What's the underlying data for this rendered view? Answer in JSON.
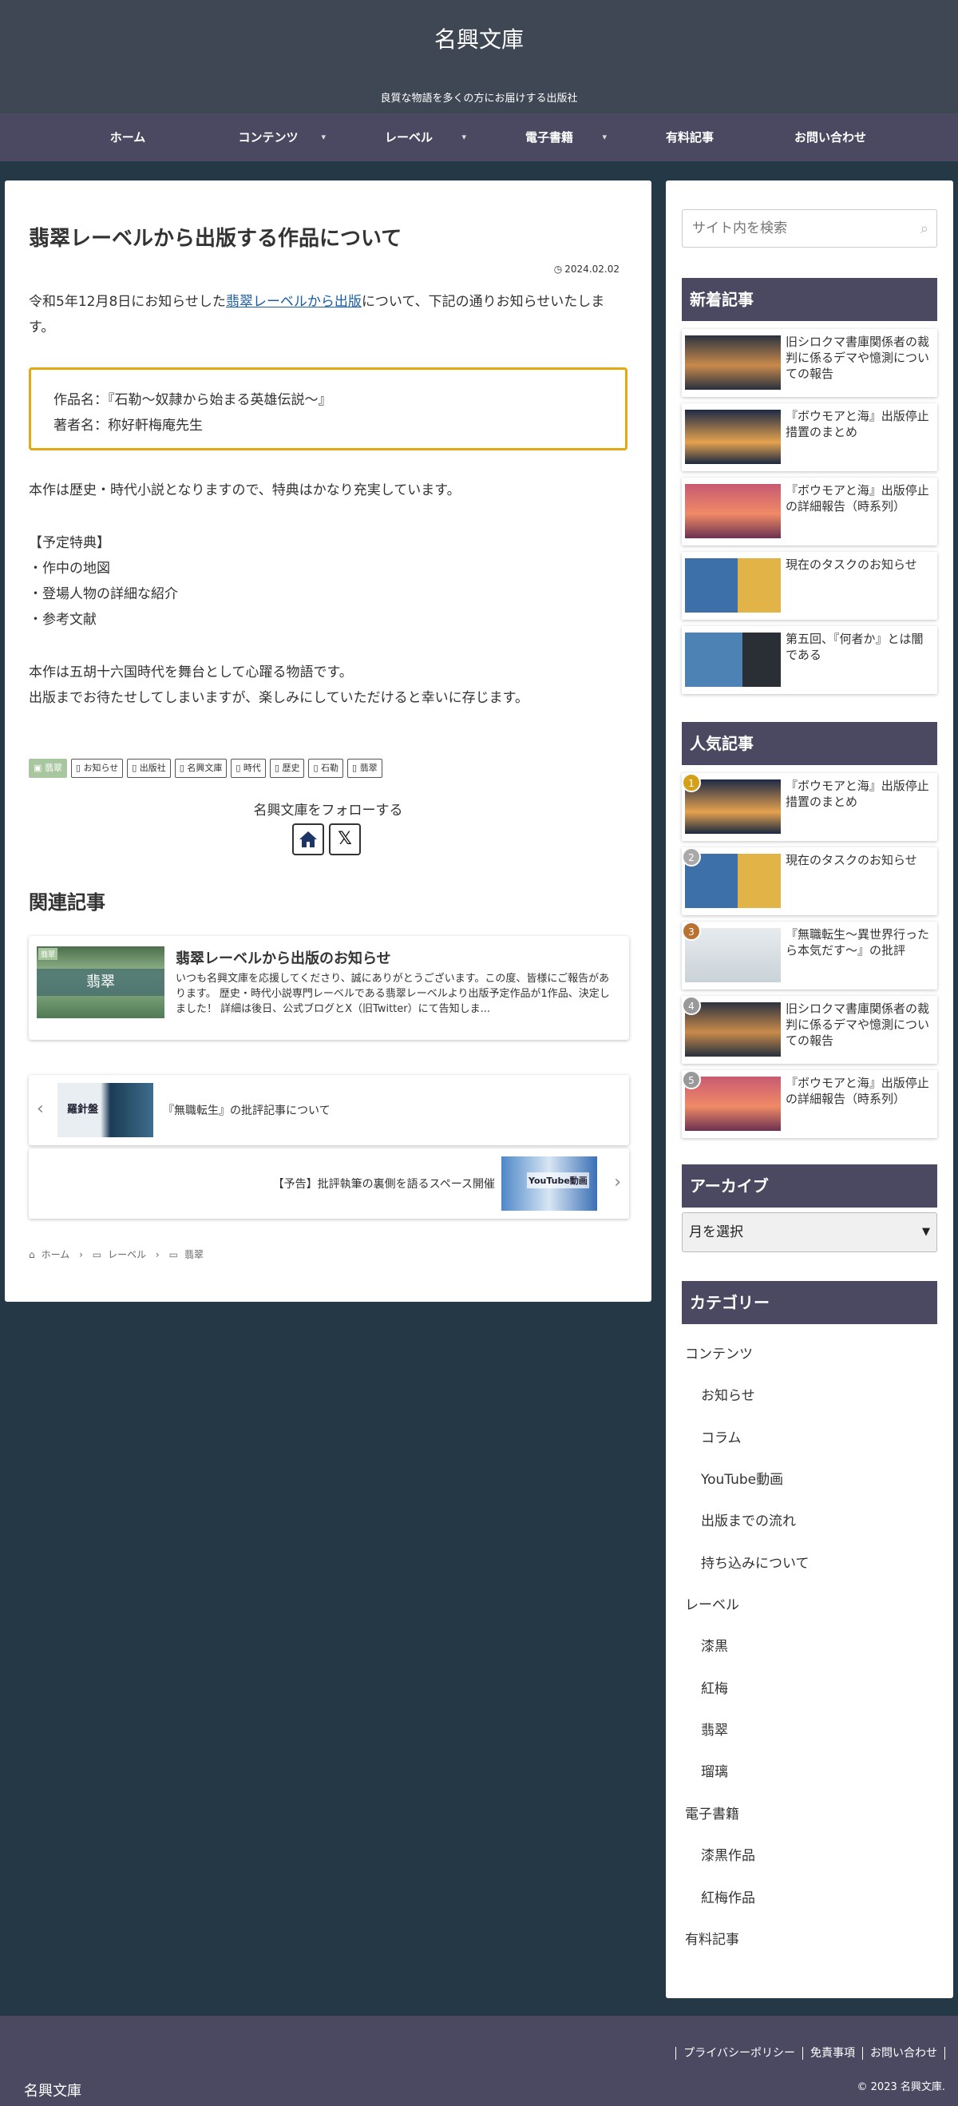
{
  "header": {
    "title": "名興文庫",
    "tagline": "良質な物語を多くの方にお届けする出版社"
  },
  "nav": {
    "items": [
      {
        "label": "ホーム"
      },
      {
        "label": "コンテンツ"
      },
      {
        "label": "レーベル"
      },
      {
        "label": "電子書籍"
      },
      {
        "label": "有料記事"
      },
      {
        "label": "お問い合わせ"
      }
    ]
  },
  "article": {
    "title": "翡翠レーベルから出版する作品について",
    "date": "2024.02.02",
    "intro_prefix": "令和5年12月8日にお知らせした",
    "intro_link": "翡翠レーベルから出版",
    "intro_suffix": "について、下記の通りお知らせいたします。",
    "box_line1": "作品名：『石勒〜奴隷から始まる英雄伝説〜』",
    "box_line2": "著者名：称好軒梅庵先生",
    "para2": "本作は歴史・時代小説となりますので、特典はかなり充実しています。",
    "bonus_head": "【予定特典】",
    "bonus_1": "・作中の地図",
    "bonus_2": "・登場人物の詳細な紹介",
    "bonus_3": "・参考文献",
    "para3a": "本作は五胡十六国時代を舞台として心躍る物語です。",
    "para3b": "出版までお待たせしてしまいますが、楽しみにしていただけると幸いに存じます。"
  },
  "tags": {
    "category": "翡翠",
    "items": [
      "お知らせ",
      "出版社",
      "名興文庫",
      "時代",
      "歴史",
      "石勒",
      "翡翠"
    ]
  },
  "follow": {
    "label": "名興文庫をフォローする"
  },
  "related": {
    "heading": "関連記事",
    "card": {
      "thumb_label": "翡翠",
      "thumb_text": "翡翠",
      "title": "翡翠レーベルから出版のお知らせ",
      "excerpt": "いつも名興文庫を応援してくださり、誠にありがとうございます。この度、皆様にご報告があります。 歴史・時代小説専門レーベルである翡翠レーベルより出版予定作品が1作品、決定しました！ 詳細は後日、公式ブログとX（旧Twitter）にて告知しま..."
    }
  },
  "prev_next": {
    "prev_text": "『無職転生』の批評記事について",
    "prev_thumb": "羅針盤",
    "next_text": "【予告】批評執筆の裏側を語るスペース開催",
    "next_thumb": "YouTube動画"
  },
  "breadcrumb": [
    "ホーム",
    "レーベル",
    "翡翠"
  ],
  "sidebar": {
    "search_placeholder": "サイト内を検索",
    "new_heading": "新着記事",
    "new_posts": [
      "旧シロクマ書庫関係者の裁判に係るデマや憶測についての報告",
      "『ボウモアと海』出版停止措置のまとめ",
      "『ボウモアと海』出版停止の詳細報告（時系列）",
      "現在のタスクのお知らせ",
      "第五回、『何者か』とは闇である"
    ],
    "popular_heading": "人気記事",
    "popular_posts": [
      {
        "rank": "1",
        "title": "『ボウモアと海』出版停止措置のまとめ"
      },
      {
        "rank": "2",
        "title": "現在のタスクのお知らせ"
      },
      {
        "rank": "3",
        "title": "『無職転生〜異世界行ったら本気だす〜』の批評"
      },
      {
        "rank": "4",
        "title": "旧シロクマ書庫関係者の裁判に係るデマや憶測についての報告"
      },
      {
        "rank": "5",
        "title": "『ボウモアと海』出版停止の詳細報告（時系列）"
      }
    ],
    "archive_heading": "アーカイブ",
    "archive_select": "月を選択",
    "category_heading": "カテゴリー",
    "categories": {
      "c0": "コンテンツ",
      "c1": "お知らせ",
      "c2": "コラム",
      "c3": "YouTube動画",
      "c4": "出版までの流れ",
      "c5": "持ち込みについて",
      "c6": "レーベル",
      "c7": "漆黒",
      "c8": "紅梅",
      "c9": "翡翠",
      "c10": "瑠璃",
      "c11": "電子書籍",
      "c12": "漆黒作品",
      "c13": "紅梅作品",
      "c14": "有料記事"
    }
  },
  "footer": {
    "links": [
      "プライバシーポリシー",
      "免責事項",
      "お問い合わせ"
    ],
    "logo": "名興文庫",
    "copyright": "© 2023 名興文庫."
  },
  "colors": {
    "header_bg": "#3f4755",
    "nav_bg": "#4a4961",
    "page_bg": "#243845",
    "widget_title_bg": "#4a4961",
    "box_border": "#e3a912",
    "category_tag": "#a8c7a0",
    "link": "#1a5ea8"
  }
}
